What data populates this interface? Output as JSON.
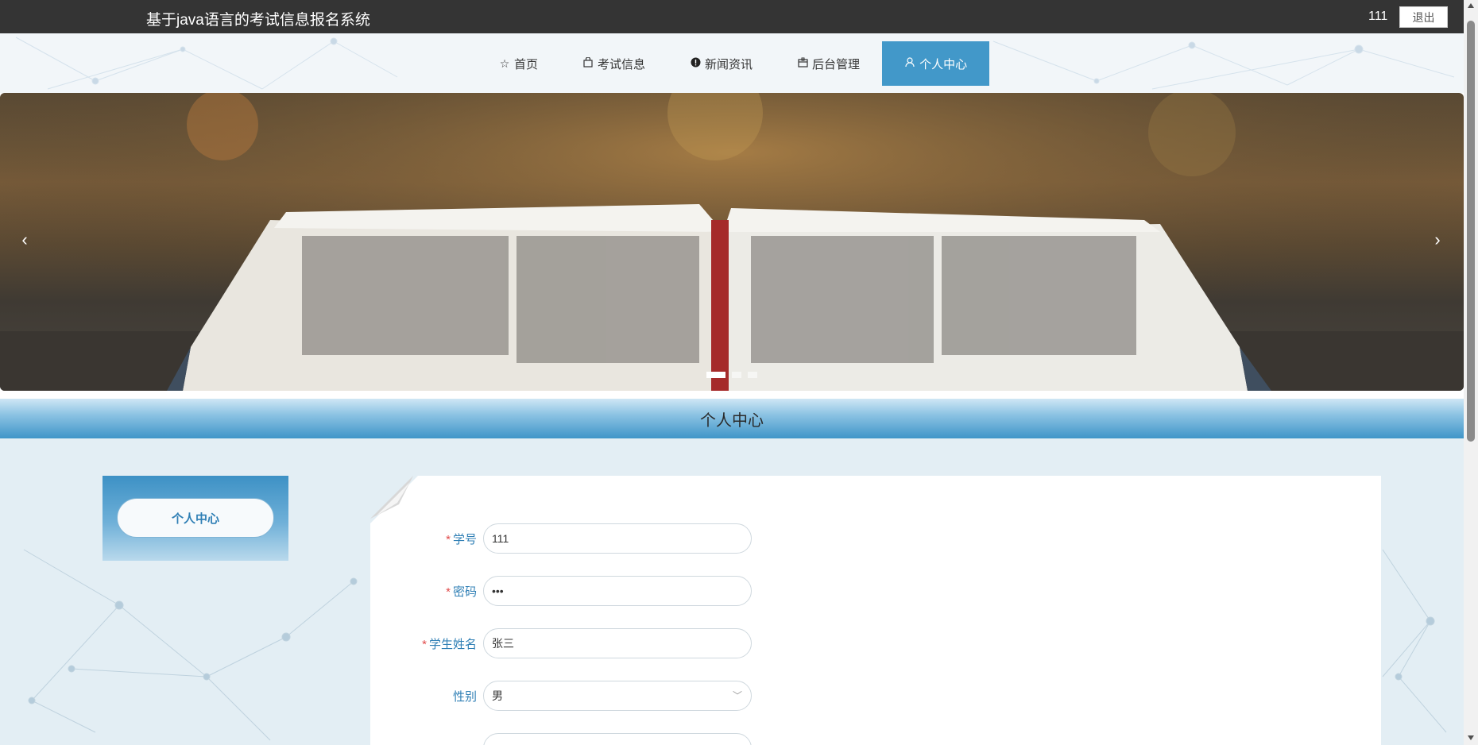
{
  "header": {
    "app_title": "基于java语言的考试信息报名系统",
    "user_name": "111",
    "logout_label": "退出"
  },
  "nav": {
    "items": [
      {
        "label": "首页",
        "icon": "star-icon",
        "glyph": "☆"
      },
      {
        "label": "考试信息",
        "icon": "bag-icon",
        "glyph": "🛍"
      },
      {
        "label": "新闻资讯",
        "icon": "info-icon",
        "glyph": "❗"
      },
      {
        "label": "后台管理",
        "icon": "box-icon",
        "glyph": "▣"
      },
      {
        "label": "个人中心",
        "icon": "user-icon",
        "glyph": "👤",
        "active": true
      }
    ]
  },
  "banner": {
    "prev_glyph": "‹",
    "next_glyph": "›",
    "slide_count": 3,
    "active_slide": 1
  },
  "section": {
    "title": "个人中心"
  },
  "sidebar": {
    "button_label": "个人中心"
  },
  "form": {
    "fields": [
      {
        "label": "学号",
        "required": true,
        "value": "111",
        "type": "text"
      },
      {
        "label": "密码",
        "required": true,
        "value": "•••",
        "type": "password"
      },
      {
        "label": "学生姓名",
        "required": true,
        "value": "张三",
        "type": "text"
      },
      {
        "label": "性别",
        "required": false,
        "value": "男",
        "type": "select"
      }
    ],
    "required_mark": "*",
    "select_chevron": "﹀"
  },
  "colors": {
    "topbar": "#343434",
    "accent": "#4298c9",
    "label": "#2f7fb5",
    "required": "#e14b4b"
  }
}
